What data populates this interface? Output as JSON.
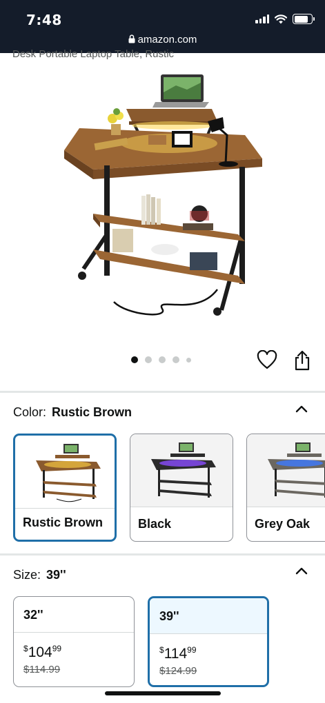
{
  "status_bar": {
    "time": "7:48",
    "url": "amazon.com"
  },
  "product": {
    "title_fragment": "Desk Portable Laptop Table, Rustic",
    "image_count": 5,
    "active_image_index": 0
  },
  "color_selector": {
    "label": "Color:",
    "selected": "Rustic Brown",
    "options": [
      {
        "name": "Rustic Brown",
        "selected": true,
        "top_color": "#8a5a2e",
        "light_color": "#f4c542"
      },
      {
        "name": "Black",
        "selected": false,
        "top_color": "#2b2b2b",
        "light_color": "#8a4cff"
      },
      {
        "name": "Grey Oak",
        "selected": false,
        "top_color": "#6b6760",
        "light_color": "#3d7bff"
      }
    ]
  },
  "size_selector": {
    "label": "Size:",
    "selected": "39''",
    "options": [
      {
        "size": "32''",
        "currency": "$",
        "price_whole": "104",
        "price_cents": "99",
        "list_price": "$114.99",
        "selected": false
      },
      {
        "size": "39''",
        "currency": "$",
        "price_whole": "114",
        "price_cents": "99",
        "list_price": "$124.99",
        "selected": true
      }
    ]
  },
  "colors": {
    "status_bar_bg": "#141c2a",
    "selected_border": "#1f6fa8",
    "selected_header_bg": "#edf8ff"
  },
  "icons": [
    "lock-icon",
    "signal-icon",
    "wifi-icon",
    "battery-icon",
    "heart-icon",
    "share-icon",
    "chevron-up-icon"
  ]
}
